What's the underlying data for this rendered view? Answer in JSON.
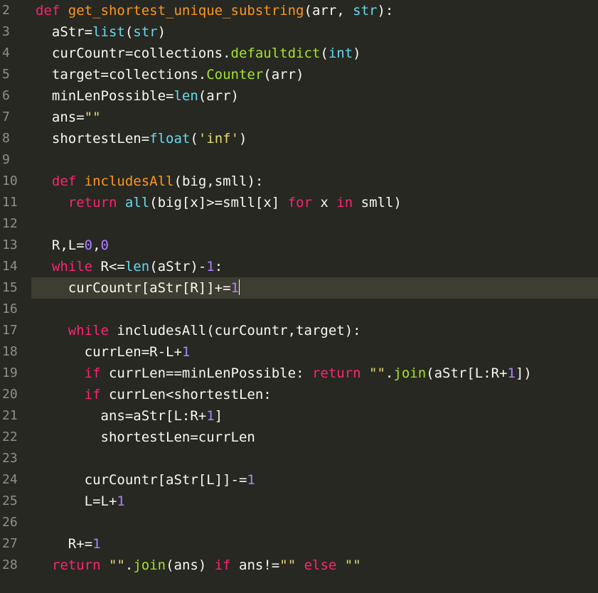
{
  "theme": {
    "background": "#272822",
    "active_line": "#3e3d32",
    "gutter_text": "#8f908a",
    "default": "#f8f8f2",
    "keyword": "#f92672",
    "function_def": "#fd971f",
    "builtin": "#66d9ef",
    "number": "#ae81ff",
    "string": "#e6db74",
    "method": "#a6e22e"
  },
  "editor": {
    "active_line": "15",
    "lines": [
      {
        "num": "2",
        "tokens": [
          {
            "t": "def ",
            "c": "keyword"
          },
          {
            "t": "get_shortest_unique_substring",
            "c": "function_def"
          },
          {
            "t": "(arr, ",
            "c": "default"
          },
          {
            "t": "str",
            "c": "builtin"
          },
          {
            "t": "):",
            "c": "default"
          }
        ]
      },
      {
        "num": "3",
        "tokens": [
          {
            "t": "  aStr=",
            "c": "default"
          },
          {
            "t": "list",
            "c": "builtin"
          },
          {
            "t": "(",
            "c": "default"
          },
          {
            "t": "str",
            "c": "builtin"
          },
          {
            "t": ")",
            "c": "default"
          }
        ]
      },
      {
        "num": "4",
        "tokens": [
          {
            "t": "  curCountr=collections.",
            "c": "default"
          },
          {
            "t": "defaultdict",
            "c": "method"
          },
          {
            "t": "(",
            "c": "default"
          },
          {
            "t": "int",
            "c": "builtin"
          },
          {
            "t": ")",
            "c": "default"
          }
        ]
      },
      {
        "num": "5",
        "tokens": [
          {
            "t": "  target=collections.",
            "c": "default"
          },
          {
            "t": "Counter",
            "c": "method"
          },
          {
            "t": "(arr)",
            "c": "default"
          }
        ]
      },
      {
        "num": "6",
        "tokens": [
          {
            "t": "  minLenPossible=",
            "c": "default"
          },
          {
            "t": "len",
            "c": "builtin"
          },
          {
            "t": "(arr)",
            "c": "default"
          }
        ]
      },
      {
        "num": "7",
        "tokens": [
          {
            "t": "  ans=",
            "c": "default"
          },
          {
            "t": "\"\"",
            "c": "string"
          }
        ]
      },
      {
        "num": "8",
        "tokens": [
          {
            "t": "  shortestLen=",
            "c": "default"
          },
          {
            "t": "float",
            "c": "builtin"
          },
          {
            "t": "(",
            "c": "default"
          },
          {
            "t": "'inf'",
            "c": "string"
          },
          {
            "t": ")",
            "c": "default"
          }
        ]
      },
      {
        "num": "9",
        "tokens": []
      },
      {
        "num": "10",
        "tokens": [
          {
            "t": "  ",
            "c": "default"
          },
          {
            "t": "def ",
            "c": "keyword"
          },
          {
            "t": "includesAll",
            "c": "function_def"
          },
          {
            "t": "(big,smll):",
            "c": "default"
          }
        ]
      },
      {
        "num": "11",
        "tokens": [
          {
            "t": "    ",
            "c": "default"
          },
          {
            "t": "return ",
            "c": "keyword"
          },
          {
            "t": "all",
            "c": "builtin"
          },
          {
            "t": "(big[x]>=smll[x] ",
            "c": "default"
          },
          {
            "t": "for ",
            "c": "keyword"
          },
          {
            "t": "x ",
            "c": "default"
          },
          {
            "t": "in ",
            "c": "keyword"
          },
          {
            "t": "smll)",
            "c": "default"
          }
        ]
      },
      {
        "num": "12",
        "tokens": []
      },
      {
        "num": "13",
        "tokens": [
          {
            "t": "  R,L=",
            "c": "default"
          },
          {
            "t": "0",
            "c": "number"
          },
          {
            "t": ",",
            "c": "default"
          },
          {
            "t": "0",
            "c": "number"
          }
        ]
      },
      {
        "num": "14",
        "tokens": [
          {
            "t": "  ",
            "c": "default"
          },
          {
            "t": "while ",
            "c": "keyword"
          },
          {
            "t": "R<=",
            "c": "default"
          },
          {
            "t": "len",
            "c": "builtin"
          },
          {
            "t": "(aStr)-",
            "c": "default"
          },
          {
            "t": "1",
            "c": "number"
          },
          {
            "t": ":",
            "c": "default"
          }
        ]
      },
      {
        "num": "15",
        "tokens": [
          {
            "t": "    curCountr[aStr[R]]+=",
            "c": "default"
          },
          {
            "t": "1",
            "c": "number"
          }
        ]
      },
      {
        "num": "16",
        "tokens": []
      },
      {
        "num": "17",
        "tokens": [
          {
            "t": "    ",
            "c": "default"
          },
          {
            "t": "while ",
            "c": "keyword"
          },
          {
            "t": "includesAll(curCountr,target):",
            "c": "default"
          }
        ]
      },
      {
        "num": "18",
        "tokens": [
          {
            "t": "      currLen=R-L+",
            "c": "default"
          },
          {
            "t": "1",
            "c": "number"
          }
        ]
      },
      {
        "num": "19",
        "tokens": [
          {
            "t": "      ",
            "c": "default"
          },
          {
            "t": "if ",
            "c": "keyword"
          },
          {
            "t": "currLen==minLenPossible: ",
            "c": "default"
          },
          {
            "t": "return ",
            "c": "keyword"
          },
          {
            "t": "\"\"",
            "c": "string"
          },
          {
            "t": ".",
            "c": "default"
          },
          {
            "t": "join",
            "c": "method"
          },
          {
            "t": "(aStr[L:R+",
            "c": "default"
          },
          {
            "t": "1",
            "c": "number"
          },
          {
            "t": "])",
            "c": "default"
          }
        ]
      },
      {
        "num": "20",
        "tokens": [
          {
            "t": "      ",
            "c": "default"
          },
          {
            "t": "if ",
            "c": "keyword"
          },
          {
            "t": "currLen<shortestLen:",
            "c": "default"
          }
        ]
      },
      {
        "num": "21",
        "tokens": [
          {
            "t": "        ans=aStr[L:R+",
            "c": "default"
          },
          {
            "t": "1",
            "c": "number"
          },
          {
            "t": "]",
            "c": "default"
          }
        ]
      },
      {
        "num": "22",
        "tokens": [
          {
            "t": "        shortestLen=currLen",
            "c": "default"
          }
        ]
      },
      {
        "num": "23",
        "tokens": []
      },
      {
        "num": "24",
        "tokens": [
          {
            "t": "      curCountr[aStr[L]]-=",
            "c": "default"
          },
          {
            "t": "1",
            "c": "number"
          }
        ]
      },
      {
        "num": "25",
        "tokens": [
          {
            "t": "      L=L+",
            "c": "default"
          },
          {
            "t": "1",
            "c": "number"
          }
        ]
      },
      {
        "num": "26",
        "tokens": []
      },
      {
        "num": "27",
        "tokens": [
          {
            "t": "    R+=",
            "c": "default"
          },
          {
            "t": "1",
            "c": "number"
          }
        ]
      },
      {
        "num": "28",
        "tokens": [
          {
            "t": "  ",
            "c": "default"
          },
          {
            "t": "return ",
            "c": "keyword"
          },
          {
            "t": "\"\"",
            "c": "string"
          },
          {
            "t": ".",
            "c": "default"
          },
          {
            "t": "join",
            "c": "method"
          },
          {
            "t": "(ans) ",
            "c": "default"
          },
          {
            "t": "if ",
            "c": "keyword"
          },
          {
            "t": "ans!=",
            "c": "default"
          },
          {
            "t": "\"\" ",
            "c": "string"
          },
          {
            "t": "else ",
            "c": "keyword"
          },
          {
            "t": "\"\"",
            "c": "string"
          }
        ]
      }
    ]
  }
}
